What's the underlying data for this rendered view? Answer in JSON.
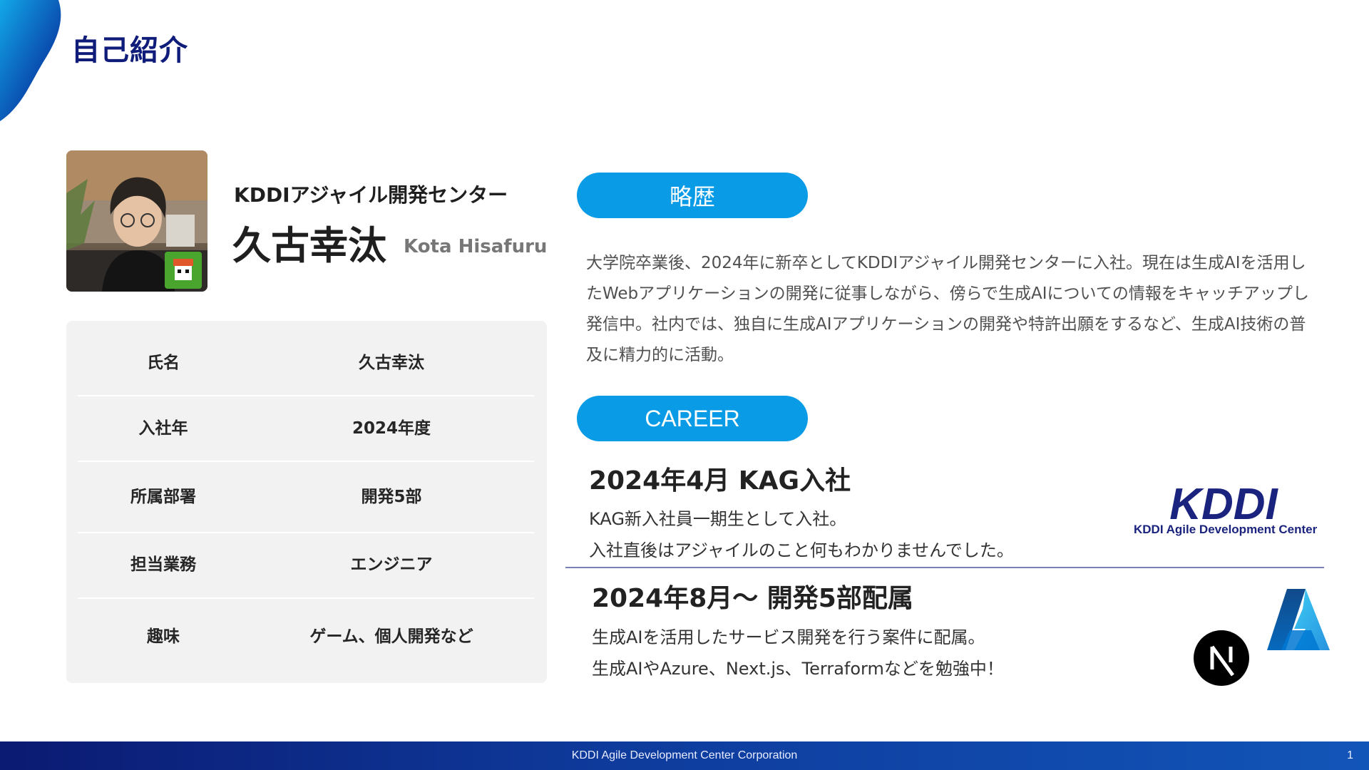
{
  "header": {
    "title": "自己紹介"
  },
  "profile": {
    "organization": "KDDIアジャイル開発センター",
    "name": "久古幸汰",
    "name_en": "Kota Hisafuru",
    "info": [
      {
        "label": "氏名",
        "value": "久古幸汰"
      },
      {
        "label": "入社年",
        "value": "2024年度"
      },
      {
        "label": "所属部署",
        "value": "開発5部"
      },
      {
        "label": "担当業務",
        "value": "エンジニア"
      },
      {
        "label": "趣味",
        "value": "ゲーム、個人開発など"
      }
    ]
  },
  "history": {
    "heading": "略歴",
    "text": "大学院卒業後、2024年に新卒としてKDDIアジャイル開発センターに入社。現在は生成AIを活用したWebアプリケーションの開発に従事しながら、傍らで生成AIについての情報をキャッチアップし発信中。社内では、独自に生成AIアプリケーションの開発や特許出願をするなど、生成AI技術の普及に精力的に活動。"
  },
  "career": {
    "heading": "CAREER",
    "entries": [
      {
        "title": "2024年4月 KAG入社",
        "lines": [
          "KAG新入社員一期生として入社。",
          "入社直後はアジャイルのこと何もわかりませんでした。"
        ]
      },
      {
        "title": "2024年8月～ 開発5部配属",
        "lines": [
          "生成AIを活用したサービス開発を行う案件に配属。",
          "生成AIやAzure、Next.js、Terraformなどを勉強中！"
        ]
      }
    ]
  },
  "logos": {
    "kddi_mark": "KDDI",
    "kddi_caption": "KDDI Agile Development Center",
    "nextjs_icon": "nextjs-icon",
    "azure_icon": "azure-icon"
  },
  "footer": {
    "company": "KDDI Agile Development Center Corporation",
    "page_number": "1"
  },
  "colors": {
    "title": "#0f1c7a",
    "accent": "#0a9be6",
    "footer": "#0e3b9c"
  }
}
